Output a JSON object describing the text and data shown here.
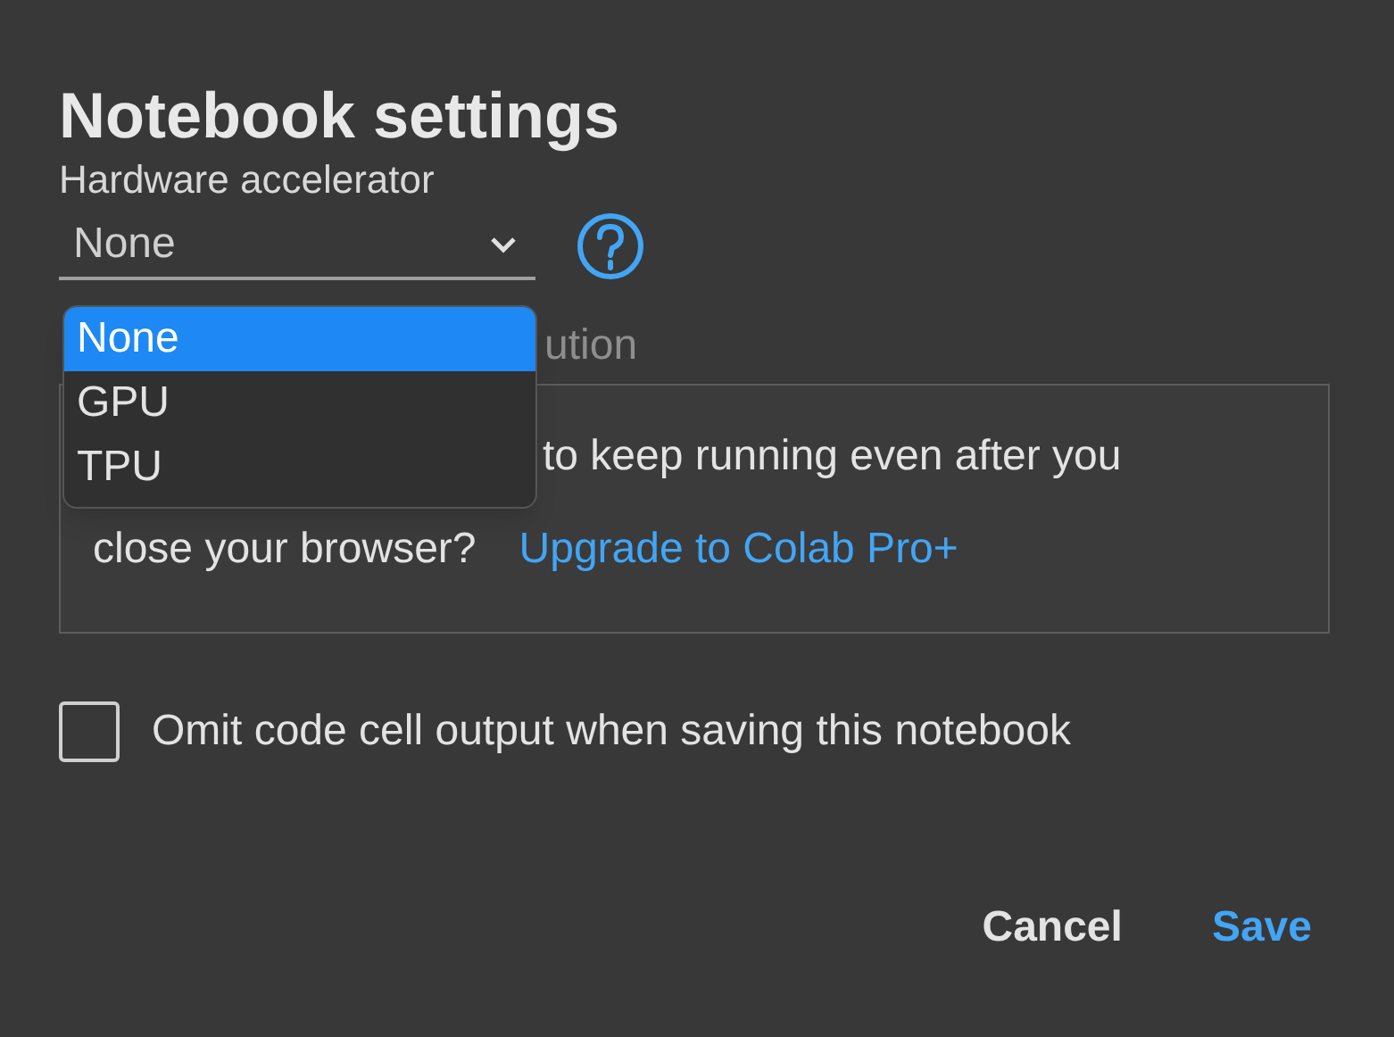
{
  "dialog": {
    "title": "Notebook settings",
    "hardware_accelerator": {
      "label": "Hardware accelerator",
      "value": "None",
      "expanded": true,
      "options": [
        {
          "label": "None",
          "selected": true
        },
        {
          "label": "GPU",
          "selected": false
        },
        {
          "label": "TPU",
          "selected": false
        }
      ]
    },
    "background_execution_label": "ution",
    "promo": {
      "line_1": "to keep running even after you",
      "line_2": "close your browser?",
      "link": "Upgrade to Colab Pro+"
    },
    "omit_output": {
      "label": "Omit code cell output when saving this notebook",
      "checked": false
    },
    "buttons": [
      {
        "label": "Cancel",
        "kind": "secondary"
      },
      {
        "label": "Save",
        "kind": "primary"
      }
    ]
  }
}
